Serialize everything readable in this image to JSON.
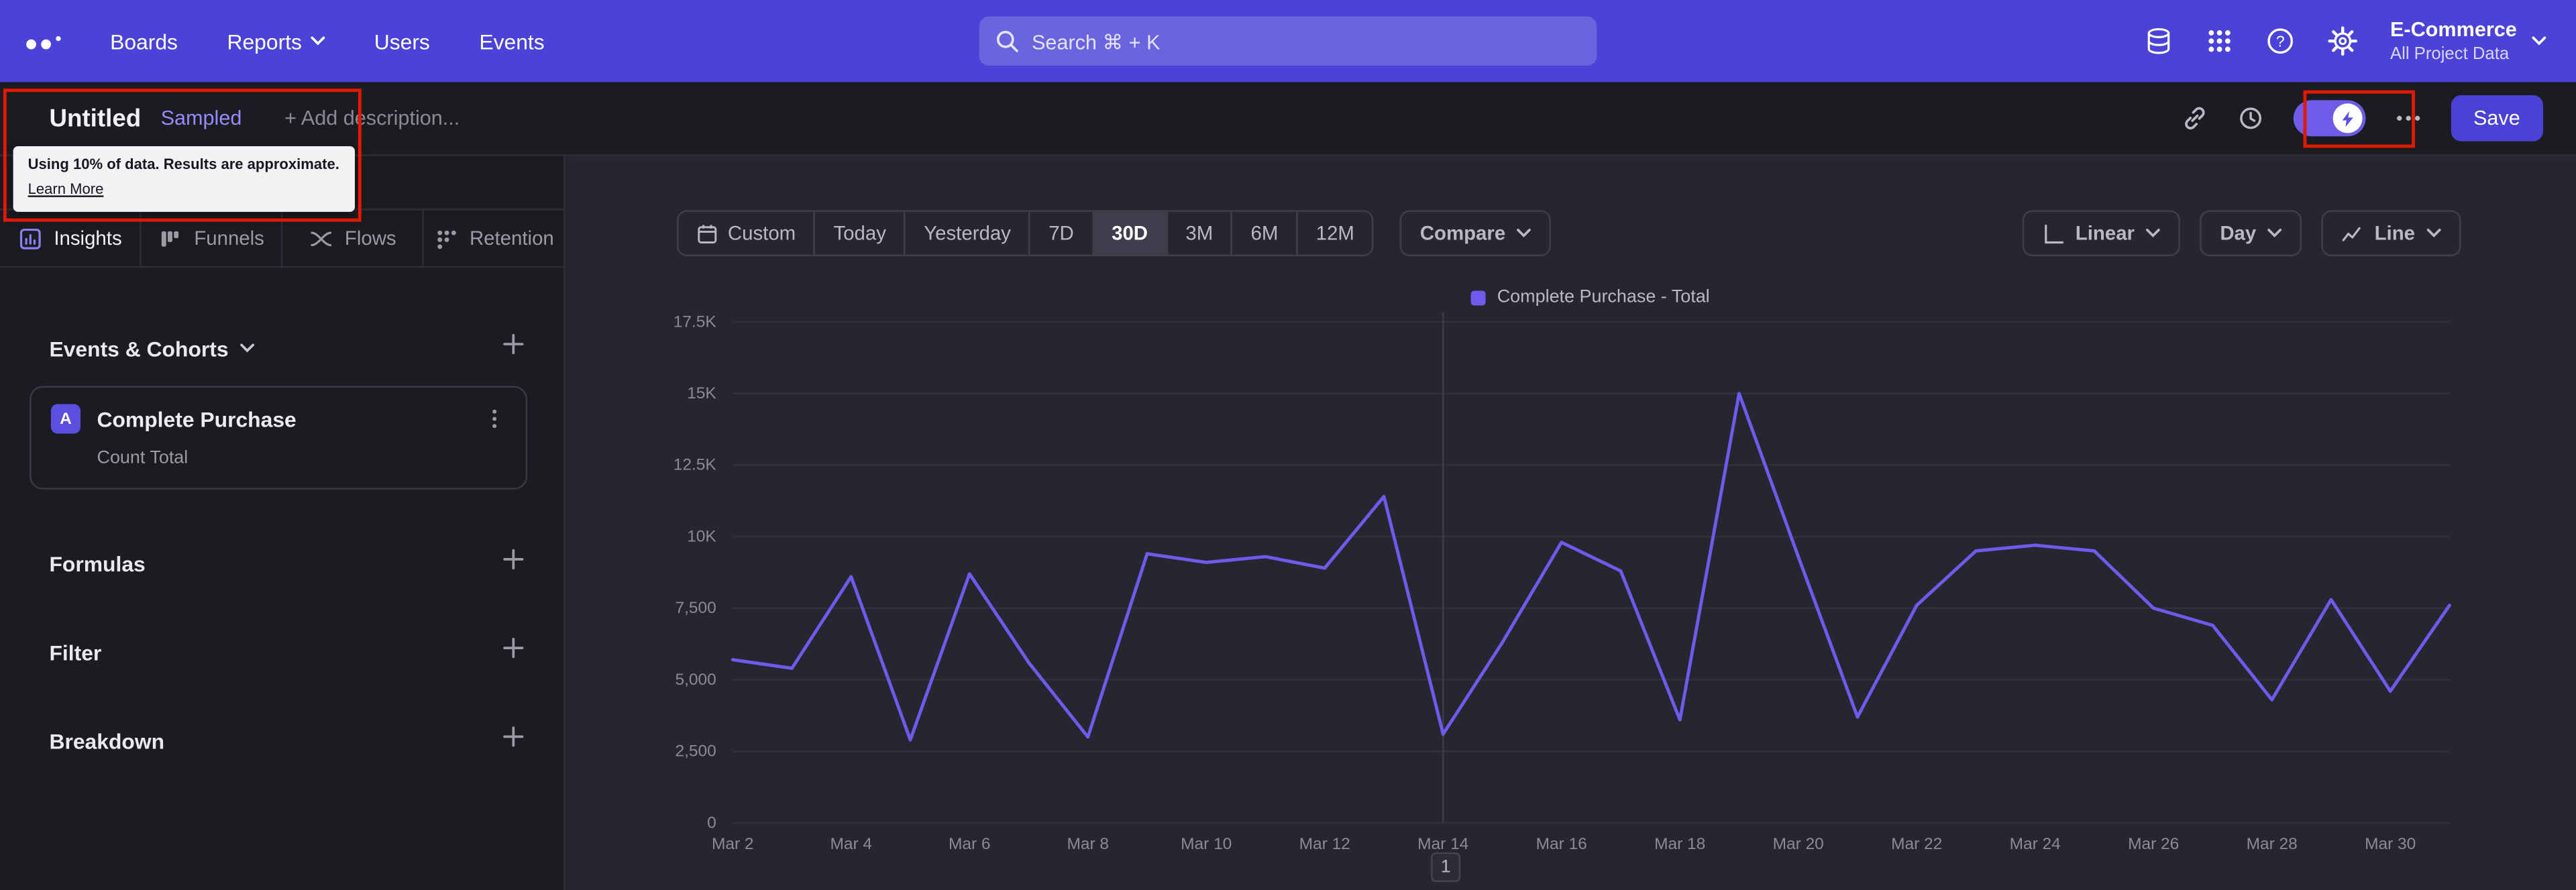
{
  "topnav": {
    "items": [
      "Boards",
      "Reports",
      "Users",
      "Events"
    ],
    "search_placeholder": "Search  ⌘ + K",
    "project_name": "E-Commerce",
    "project_subtitle": "All Project Data"
  },
  "titlebar": {
    "title": "Untitled",
    "badge": "Sampled",
    "description_placeholder": "+ Add description...",
    "save_label": "Save"
  },
  "tooltip": {
    "message": "Using 10% of data. Results are approximate.",
    "link": "Learn More"
  },
  "sidebar": {
    "tabs": [
      {
        "label": "Insights",
        "active": true
      },
      {
        "label": "Funnels",
        "active": false
      },
      {
        "label": "Flows",
        "active": false
      },
      {
        "label": "Retention",
        "active": false
      }
    ],
    "events_header": "Events & Cohorts",
    "event_card": {
      "badge": "A",
      "name": "Complete Purchase",
      "metric": "Count Total"
    },
    "others": [
      "Formulas",
      "Filter",
      "Breakdown"
    ]
  },
  "controls": {
    "date_ranges": [
      "Custom",
      "Today",
      "Yesterday",
      "7D",
      "30D",
      "3M",
      "6M",
      "12M"
    ],
    "active_range": "30D",
    "compare_label": "Compare",
    "right_buttons": [
      "Linear",
      "Day",
      "Line"
    ]
  },
  "chart_data": {
    "type": "line",
    "title": "",
    "legend": [
      "Complete Purchase - Total"
    ],
    "x": [
      "Mar 2",
      "Mar 3",
      "Mar 4",
      "Mar 5",
      "Mar 6",
      "Mar 7",
      "Mar 8",
      "Mar 9",
      "Mar 10",
      "Mar 11",
      "Mar 12",
      "Mar 13",
      "Mar 14",
      "Mar 15",
      "Mar 16",
      "Mar 17",
      "Mar 18",
      "Mar 19",
      "Mar 20",
      "Mar 21",
      "Mar 22",
      "Mar 23",
      "Mar 24",
      "Mar 25",
      "Mar 26",
      "Mar 27",
      "Mar 28",
      "Mar 29",
      "Mar 30",
      "Mar 31"
    ],
    "series": [
      {
        "name": "Complete Purchase - Total",
        "values": [
          5700,
          5400,
          8600,
          2900,
          8700,
          5600,
          3000,
          9400,
          9100,
          9300,
          8900,
          11400,
          3100,
          6300,
          9800,
          8800,
          3600,
          15000,
          9300,
          3700,
          7600,
          9500,
          9700,
          9500,
          7500,
          6900,
          4300,
          7800,
          4600,
          7600
        ]
      }
    ],
    "x_tick_labels": [
      "Mar 2",
      "Mar 4",
      "Mar 6",
      "Mar 8",
      "Mar 10",
      "Mar 12",
      "Mar 14",
      "Mar 16",
      "Mar 18",
      "Mar 20",
      "Mar 22",
      "Mar 24",
      "Mar 26",
      "Mar 28",
      "Mar 30"
    ],
    "y_ticks": [
      0,
      2500,
      5000,
      7500,
      10000,
      12500,
      15000,
      17500
    ],
    "y_tick_labels": [
      "0",
      "2,500",
      "5,000",
      "7,500",
      "10K",
      "12.5K",
      "15K",
      "17.5K"
    ],
    "ylim": [
      0,
      17500
    ],
    "grid": true,
    "legend_position": "top-center",
    "line_color": "#6e5aec",
    "vertical_marker_x": "Mar 14",
    "pagination": "1"
  },
  "colors": {
    "topnav_bg": "#4b42d8",
    "panel_bg": "#1b1b22",
    "canvas_bg": "#26262e",
    "accent": "#5a4fe0",
    "line": "#6e5aec",
    "badge_text": "#958cf9",
    "annotation_red": "#e11900"
  }
}
